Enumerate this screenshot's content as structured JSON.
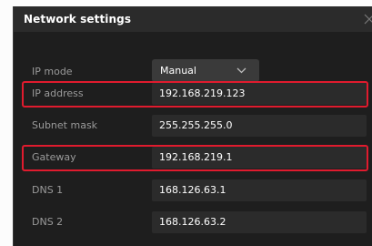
{
  "dialog": {
    "title": "Network settings",
    "close_icon": "close-icon"
  },
  "fields": {
    "ip_mode": {
      "label": "IP mode",
      "value": "Manual",
      "icon": "chevron-down-icon"
    },
    "ip_address": {
      "label": "IP address",
      "value": "192.168.219.123"
    },
    "subnet_mask": {
      "label": "Subnet mask",
      "value": "255.255.255.0"
    },
    "gateway": {
      "label": "Gateway",
      "value": "192.168.219.1"
    },
    "dns1": {
      "label": "DNS 1",
      "value": "168.126.63.1"
    },
    "dns2": {
      "label": "DNS 2",
      "value": "168.126.63.2"
    }
  },
  "colors": {
    "highlight": "#e01b2e",
    "background": "#1e1e1e",
    "titlebar": "#2b2b2b",
    "field": "#2b2b2b",
    "select": "#3a3a3a"
  }
}
